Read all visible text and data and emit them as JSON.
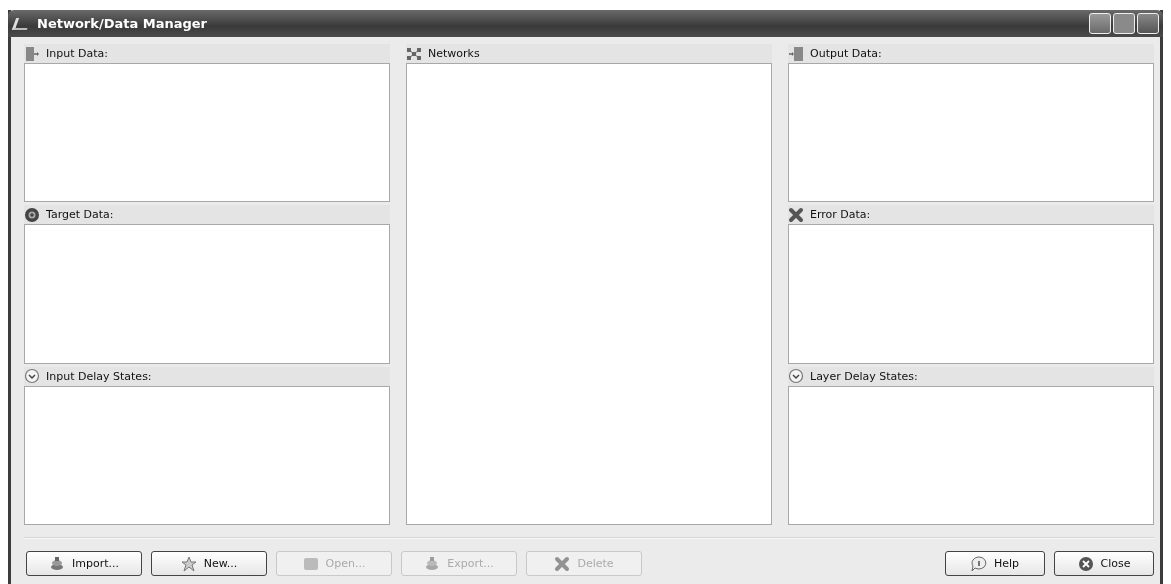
{
  "window": {
    "title": "Network/Data Manager"
  },
  "columns": [
    {
      "sections": [
        {
          "label": "Input Data:",
          "kind": "input"
        },
        {
          "label": "Target Data:",
          "kind": "target"
        },
        {
          "label": "Input Delay States:",
          "kind": "delay"
        }
      ]
    },
    {
      "sections": [
        {
          "label": "Networks",
          "kind": "network"
        }
      ]
    },
    {
      "sections": [
        {
          "label": "Output Data:",
          "kind": "output"
        },
        {
          "label": "Error Data:",
          "kind": "error"
        },
        {
          "label": "Layer Delay States:",
          "kind": "delay"
        }
      ]
    }
  ],
  "buttons_left": [
    {
      "label": "Import...",
      "kind": "import",
      "disabled": false
    },
    {
      "label": "New...",
      "kind": "new",
      "disabled": false
    },
    {
      "label": "Open...",
      "kind": "open",
      "disabled": true
    },
    {
      "label": "Export...",
      "kind": "export",
      "disabled": true
    },
    {
      "label": "Delete",
      "kind": "delete",
      "disabled": true
    }
  ],
  "buttons_right": [
    {
      "label": "Help",
      "kind": "help",
      "disabled": false
    },
    {
      "label": "Close",
      "kind": "close",
      "disabled": false
    }
  ]
}
